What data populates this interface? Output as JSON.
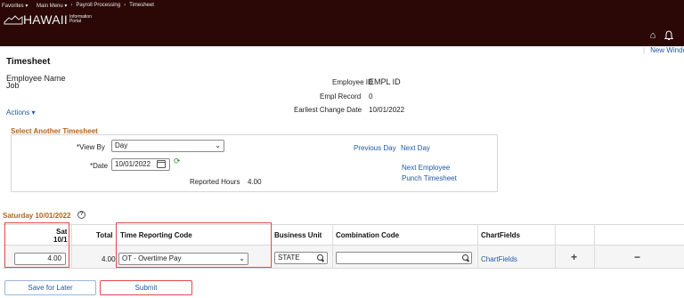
{
  "header": {
    "breadcrumbs": [
      "Favorites ▾",
      "Main Menu ▾",
      "Payroll Processing",
      "Timesheet"
    ],
    "logo": "HAWAII",
    "logo_sub": "Information Portal",
    "new_window": "New Windo"
  },
  "page": {
    "title": "Timesheet",
    "employee_name": "Employee Name",
    "job": "Job",
    "actions": "Actions ▾"
  },
  "employee": {
    "id_label": "Employee ID",
    "id_value": "EMPL ID",
    "record_label": "Empl Record",
    "record_value": "0",
    "earliest_label": "Earliest Change Date",
    "earliest_value": "10/01/2022"
  },
  "select_timesheet": {
    "title": "Select Another Timesheet",
    "view_by_label": "*View By",
    "view_by_value": "Day",
    "date_label": "*Date",
    "date_value": "10/01/2022",
    "reported_hours_label": "Reported Hours",
    "reported_hours_value": "4.00",
    "previous_day": "Previous Day",
    "next_day": "Next Day",
    "next_employee": "Next Employee",
    "punch_timesheet": "Punch Timesheet"
  },
  "day": {
    "title": "Saturday 10/01/2022",
    "help": "?"
  },
  "grid": {
    "headers": {
      "day_name": "Sat",
      "day_date": "10/1",
      "total": "Total",
      "trc": "Time Reporting Code",
      "business_unit": "Business Unit",
      "combination_code": "Combination Code",
      "chartfields": "ChartFields"
    },
    "row": {
      "hours": "4.00",
      "total": "4.00",
      "trc": "OT - Overtime Pay",
      "business_unit": "STATE",
      "combination_code": "",
      "chartfields_link": "ChartFields",
      "add": "+",
      "remove": "−"
    }
  },
  "buttons": {
    "save": "Save for Later",
    "submit": "Submit"
  },
  "colors": {
    "header_bg": "#2b0706",
    "section_title": "#b4641c",
    "link": "#1f5aa6",
    "highlight": "#e24a4a"
  }
}
